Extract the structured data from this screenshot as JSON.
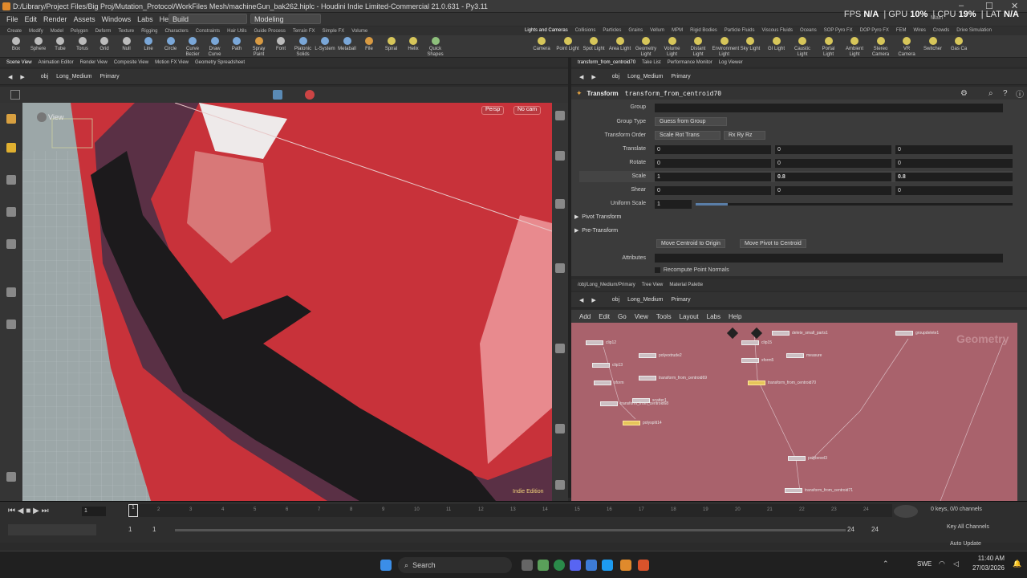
{
  "window": {
    "title": "D:/Library/Project Files/Big Proj/Mutation_Protocol/WorkFiles Mesh/machineGun_bak262.hiplc - Houdini Indie Limited-Commercial 21.0.631 - Py3.11"
  },
  "menu": [
    "File",
    "Edit",
    "Render",
    "Assets",
    "Windows",
    "Labs",
    "Help"
  ],
  "desktops": {
    "build": "Build",
    "modeling": "Modeling"
  },
  "stats": {
    "fps_label": "FPS",
    "fps": "N/A",
    "gpu_label": "GPU",
    "gpu": "10%",
    "cpu_label": "CPU",
    "cpu": "19%",
    "lat_label": "LAT",
    "lat": "N/A",
    "main": "Main"
  },
  "shelf_tabs_left": [
    "Create",
    "Modify",
    "Model",
    "Polygon",
    "Deform",
    "Texture",
    "Rigging",
    "Characters",
    "Constraints",
    "Hair Utils",
    "Guide Process",
    "Terrain FX",
    "Simple FX",
    "Volume"
  ],
  "shelf_tabs_right": [
    "Lights and Cameras",
    "Collisions",
    "Particles",
    "Grains",
    "Vellum",
    "MPM",
    "Rigid Bodies",
    "Particle Fluids",
    "Viscous Fluids",
    "Oceans",
    "SOP Pyro FX",
    "DOP Pyro FX",
    "FEM",
    "Wires",
    "Crowds",
    "Drive Simulation"
  ],
  "tools_left": [
    "Box",
    "Sphere",
    "Tube",
    "Torus",
    "Grid",
    "Null",
    "Line",
    "Circle",
    "Curve Bezier",
    "Draw Curve",
    "Path",
    "Spray Paint",
    "Font",
    "Platonic Solids",
    "L-System",
    "Metaball",
    "File",
    "Spiral",
    "Helix",
    "Quick Shapes"
  ],
  "tools_right": [
    "Camera",
    "Point Light",
    "Spot Light",
    "Area Light",
    "Geometry Light",
    "Volume Light",
    "Distant Light",
    "Environment Light",
    "Sky Light",
    "GI Light",
    "Caustic Light",
    "Portal Light",
    "Ambient Light",
    "Stereo Camera",
    "VR Camera",
    "Switcher",
    "Gas Ca"
  ],
  "left_pane_tabs": [
    "Scene View",
    "Animation Editor",
    "Render View",
    "Composite View",
    "Motion FX View",
    "Geometry Spreadsheet"
  ],
  "right_pane_tabs": [
    "transform_from_centroid70",
    "Take List",
    "Performance Monitor",
    "Log Viewer"
  ],
  "path": {
    "root": "obj",
    "object": "Long_Medium",
    "sub": "Primary"
  },
  "viewport": {
    "label": "View",
    "persp": "Persp",
    "cam": "No cam",
    "watermark": "Indie Edition"
  },
  "params": {
    "node_type": "Transform",
    "node_name": "transform_from_centroid70",
    "labels": [
      "Group",
      "Group Type",
      "Transform Order",
      "Translate",
      "Rotate",
      "Scale",
      "Shear",
      "Uniform Scale"
    ],
    "group_type": "Guess from Group",
    "order1": "Scale Rot Trans",
    "order2": "Rx Ry Rz",
    "translate": [
      "0",
      "0",
      "0"
    ],
    "rotate": [
      "0",
      "0",
      "0"
    ],
    "scale": [
      "1",
      "0.8",
      "0.8"
    ],
    "shear": [
      "0",
      "0",
      "0"
    ],
    "uniform_scale": "1",
    "uniform_scale_fraction": 0.1,
    "pivot": "Pivot Transform",
    "pretransform": "Pre-Transform",
    "btn_origin": "Move Centroid to Origin",
    "btn_pivot": "Move Pivot to Centroid",
    "attributes": "Attributes",
    "recompute": "Recompute Point Normals"
  },
  "network_tabs": [
    "/obj/Long_Medium/Primary",
    "Tree View",
    "Material Palette"
  ],
  "network_menu": [
    "Add",
    "Edit",
    "Go",
    "View",
    "Tools",
    "Layout",
    "Labs",
    "Help"
  ],
  "network_watermark": "Geometry",
  "nodes": [
    "clip12",
    "clip13",
    "polyextrude2",
    "xform",
    "transform_from_centroid69",
    "scatter1",
    "transform_from_centroid68",
    "polysplit14",
    "clip15",
    "xform5",
    "transform_from_centroid70",
    "delete_small_parts1",
    "measure",
    "groupdelete1",
    "polybevel3",
    "transform_from_centroid71"
  ],
  "timeline": {
    "frame": "1",
    "start": "1",
    "start2": "1",
    "end": "24",
    "end2": "24",
    "ticks": [
      "2",
      "3",
      "4",
      "5",
      "6",
      "7",
      "8",
      "9",
      "10",
      "11",
      "12",
      "13",
      "14",
      "15",
      "16",
      "17",
      "18",
      "19",
      "20",
      "21",
      "22",
      "23",
      "24"
    ],
    "keys": "0 keys, 0/0 channels",
    "keyall": "Key All Channels",
    "auto": "Auto Update"
  },
  "taskbar": {
    "search": "Search",
    "lang": "SWE",
    "time": "11:40 AM",
    "date": "27/03/2026"
  }
}
